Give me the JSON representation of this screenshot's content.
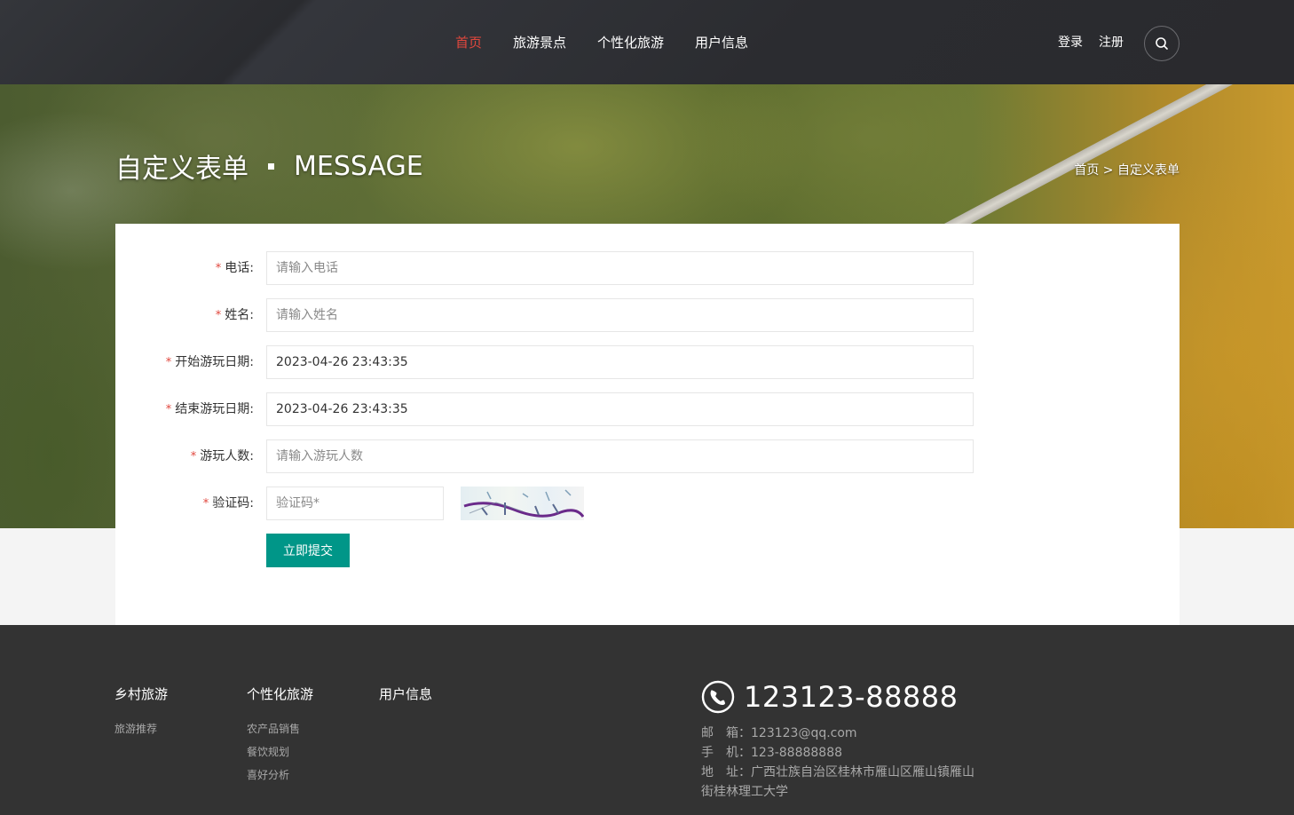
{
  "nav": {
    "items": [
      {
        "label": "首页",
        "active": true
      },
      {
        "label": "旅游景点",
        "active": false
      },
      {
        "label": "个性化旅游",
        "active": false
      },
      {
        "label": "用户信息",
        "active": false
      }
    ],
    "login": "登录",
    "register": "注册",
    "search_icon": "search-icon"
  },
  "banner": {
    "title_cn": "自定义表单",
    "title_en": "MESSAGE",
    "breadcrumb": "首页 > 自定义表单"
  },
  "form": {
    "fields": [
      {
        "label": "电话:",
        "placeholder": "请输入电话",
        "value": ""
      },
      {
        "label": "姓名:",
        "placeholder": "请输入姓名",
        "value": ""
      },
      {
        "label": "开始游玩日期:",
        "placeholder": "",
        "value": "2023-04-26 23:43:35"
      },
      {
        "label": "结束游玩日期:",
        "placeholder": "",
        "value": "2023-04-26 23:43:35"
      },
      {
        "label": "游玩人数:",
        "placeholder": "请输入游玩人数",
        "value": ""
      },
      {
        "label": "验证码:",
        "placeholder": "验证码*",
        "value": ""
      }
    ],
    "required_mark": "*",
    "submit_label": "立即提交"
  },
  "colors": {
    "accent_red": "#e1473d",
    "submit_green": "#009688",
    "footer_bg": "#333333",
    "header_bg": "#2b2c30"
  },
  "footer": {
    "columns": [
      {
        "title": "乡村旅游",
        "links": [
          "旅游推荐"
        ]
      },
      {
        "title": "个性化旅游",
        "links": [
          "农产品销售",
          "餐饮规划",
          "喜好分析"
        ]
      },
      {
        "title": "用户信息",
        "links": []
      }
    ],
    "phone": "123123-88888",
    "email": "邮　箱：123123@qq.com",
    "mobile": "手　机：123-88888888",
    "address": "地　址：广西壮族自治区桂林市雁山区雁山镇雁山街桂林理工大学"
  }
}
